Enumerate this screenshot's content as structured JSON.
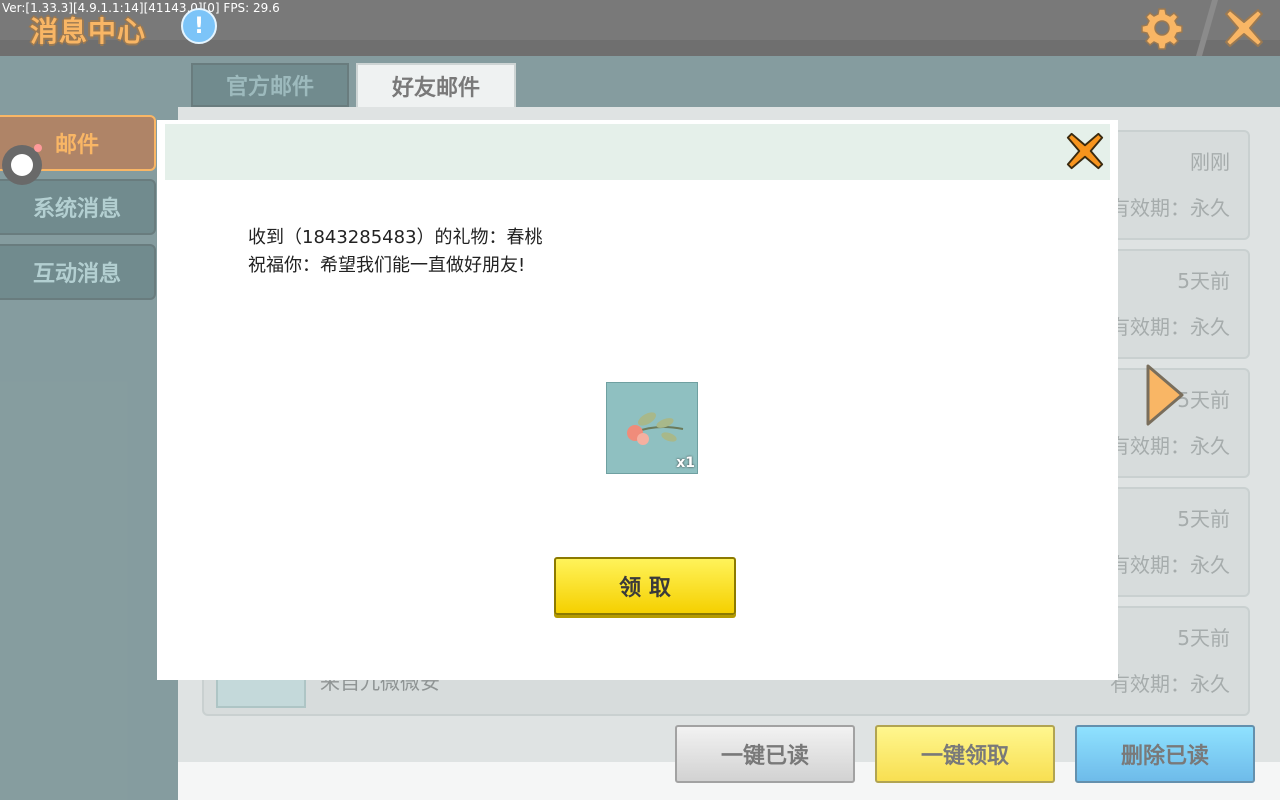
{
  "debug_text": "Ver:[1.33.3][4.9.1.1:14][41143,0][0] FPS: 29.6",
  "header": {
    "title": "消息中心",
    "info_icon": "!"
  },
  "sidebar": {
    "items": [
      {
        "label": "邮件",
        "active": true
      },
      {
        "label": "系统消息",
        "active": false
      },
      {
        "label": "互动消息",
        "active": false
      }
    ]
  },
  "tabs": [
    {
      "label": "官方邮件",
      "active": false
    },
    {
      "label": "好友邮件",
      "active": true
    }
  ],
  "mail_list": [
    {
      "time": "刚刚",
      "expire": "有效期：永久",
      "sender": ""
    },
    {
      "time": "5天前",
      "expire": "有效期：永久",
      "sender": ""
    },
    {
      "time": "5天前",
      "expire": "有效期：永久",
      "sender": ""
    },
    {
      "time": "5天前",
      "expire": "有效期：永久",
      "sender": ""
    },
    {
      "time": "5天前",
      "expire": "有效期：永久",
      "sender": "来自九微微安"
    }
  ],
  "bottom_buttons": {
    "read_all": "一键已读",
    "claim_all": "一键领取",
    "delete_read": "删除已读"
  },
  "modal": {
    "line1": "收到（1843285483）的礼物：春桃",
    "line2": "祝福你：希望我们能一直做好朋友!",
    "item_icon": "peach-blossom-icon",
    "item_qty": "x1",
    "claim_label": "领 取"
  },
  "colors": {
    "accent_orange": "#f7941d",
    "button_yellow": "#f5d000",
    "button_blue": "#2a9be0"
  }
}
